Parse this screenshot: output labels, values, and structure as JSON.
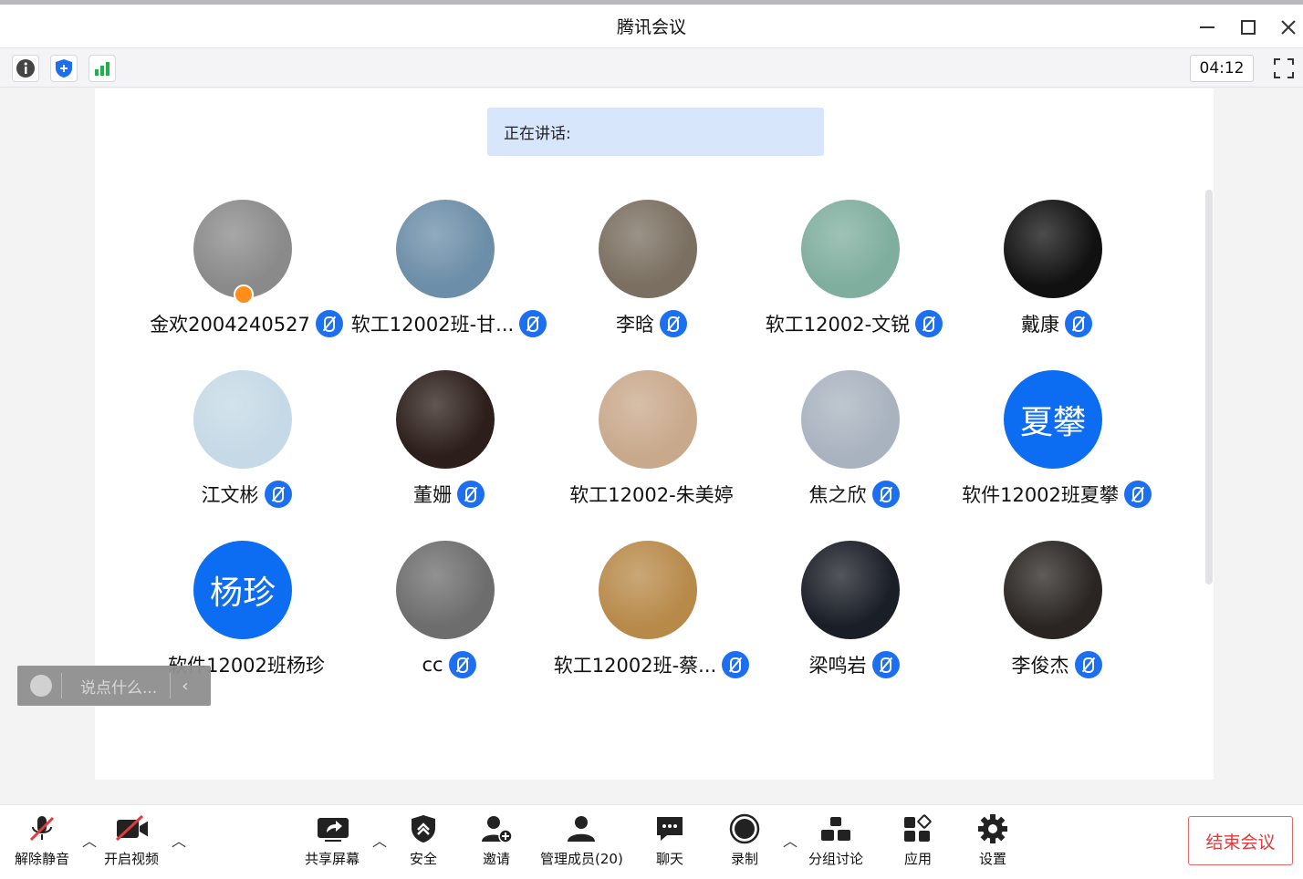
{
  "window": {
    "title": "腾讯会议"
  },
  "toolbar": {
    "timer": "04:12"
  },
  "speaking": {
    "label": "正在讲话:"
  },
  "participants": [
    {
      "name": "金欢2004240527",
      "avatar_color": "#8a8a8a",
      "host": true,
      "mic": true
    },
    {
      "name": "软工12002班-甘...",
      "avatar_color": "#6c8ea8",
      "mic": true
    },
    {
      "name": "李晗",
      "avatar_color": "#7a6f60",
      "mic": true
    },
    {
      "name": "软工12002-文锐",
      "avatar_color": "#7fae9e",
      "mic": true
    },
    {
      "name": "戴康",
      "avatar_color": "#111111",
      "mic": true
    },
    {
      "name": "江文彬",
      "avatar_color": "#c5d9e6",
      "mic": true
    },
    {
      "name": "董姗",
      "avatar_color": "#2c1e1a",
      "mic": true
    },
    {
      "name": "软工12002-朱美婷",
      "avatar_color": "#c9a98c",
      "mic": false
    },
    {
      "name": "焦之欣",
      "avatar_color": "#a9b3bf",
      "mic": true
    },
    {
      "name": "软件12002班夏攀",
      "avatar_text": "夏攀",
      "mic": true
    },
    {
      "name": "软件12002班杨珍",
      "avatar_text": "杨珍",
      "mic": false
    },
    {
      "name": "cc",
      "avatar_color": "#6d6d6d",
      "mic": true
    },
    {
      "name": "软工12002班-蔡...",
      "avatar_color": "#b88a4a",
      "mic": true
    },
    {
      "name": "梁鸣岩",
      "avatar_color": "#1a1e26",
      "mic": true
    },
    {
      "name": "李俊杰",
      "avatar_color": "#2a2522",
      "mic": true
    }
  ],
  "chat": {
    "placeholder": "说点什么..."
  },
  "bottom": {
    "unmute": "解除静音",
    "video": "开启视频",
    "share": "共享屏幕",
    "security": "安全",
    "invite": "邀请",
    "members": "管理成员(20)",
    "chat": "聊天",
    "record": "录制",
    "breakout": "分组讨论",
    "apps": "应用",
    "settings": "设置",
    "end": "结束会议"
  },
  "colors": {
    "accent": "#1d6ff2",
    "end": "#e03a3a"
  }
}
